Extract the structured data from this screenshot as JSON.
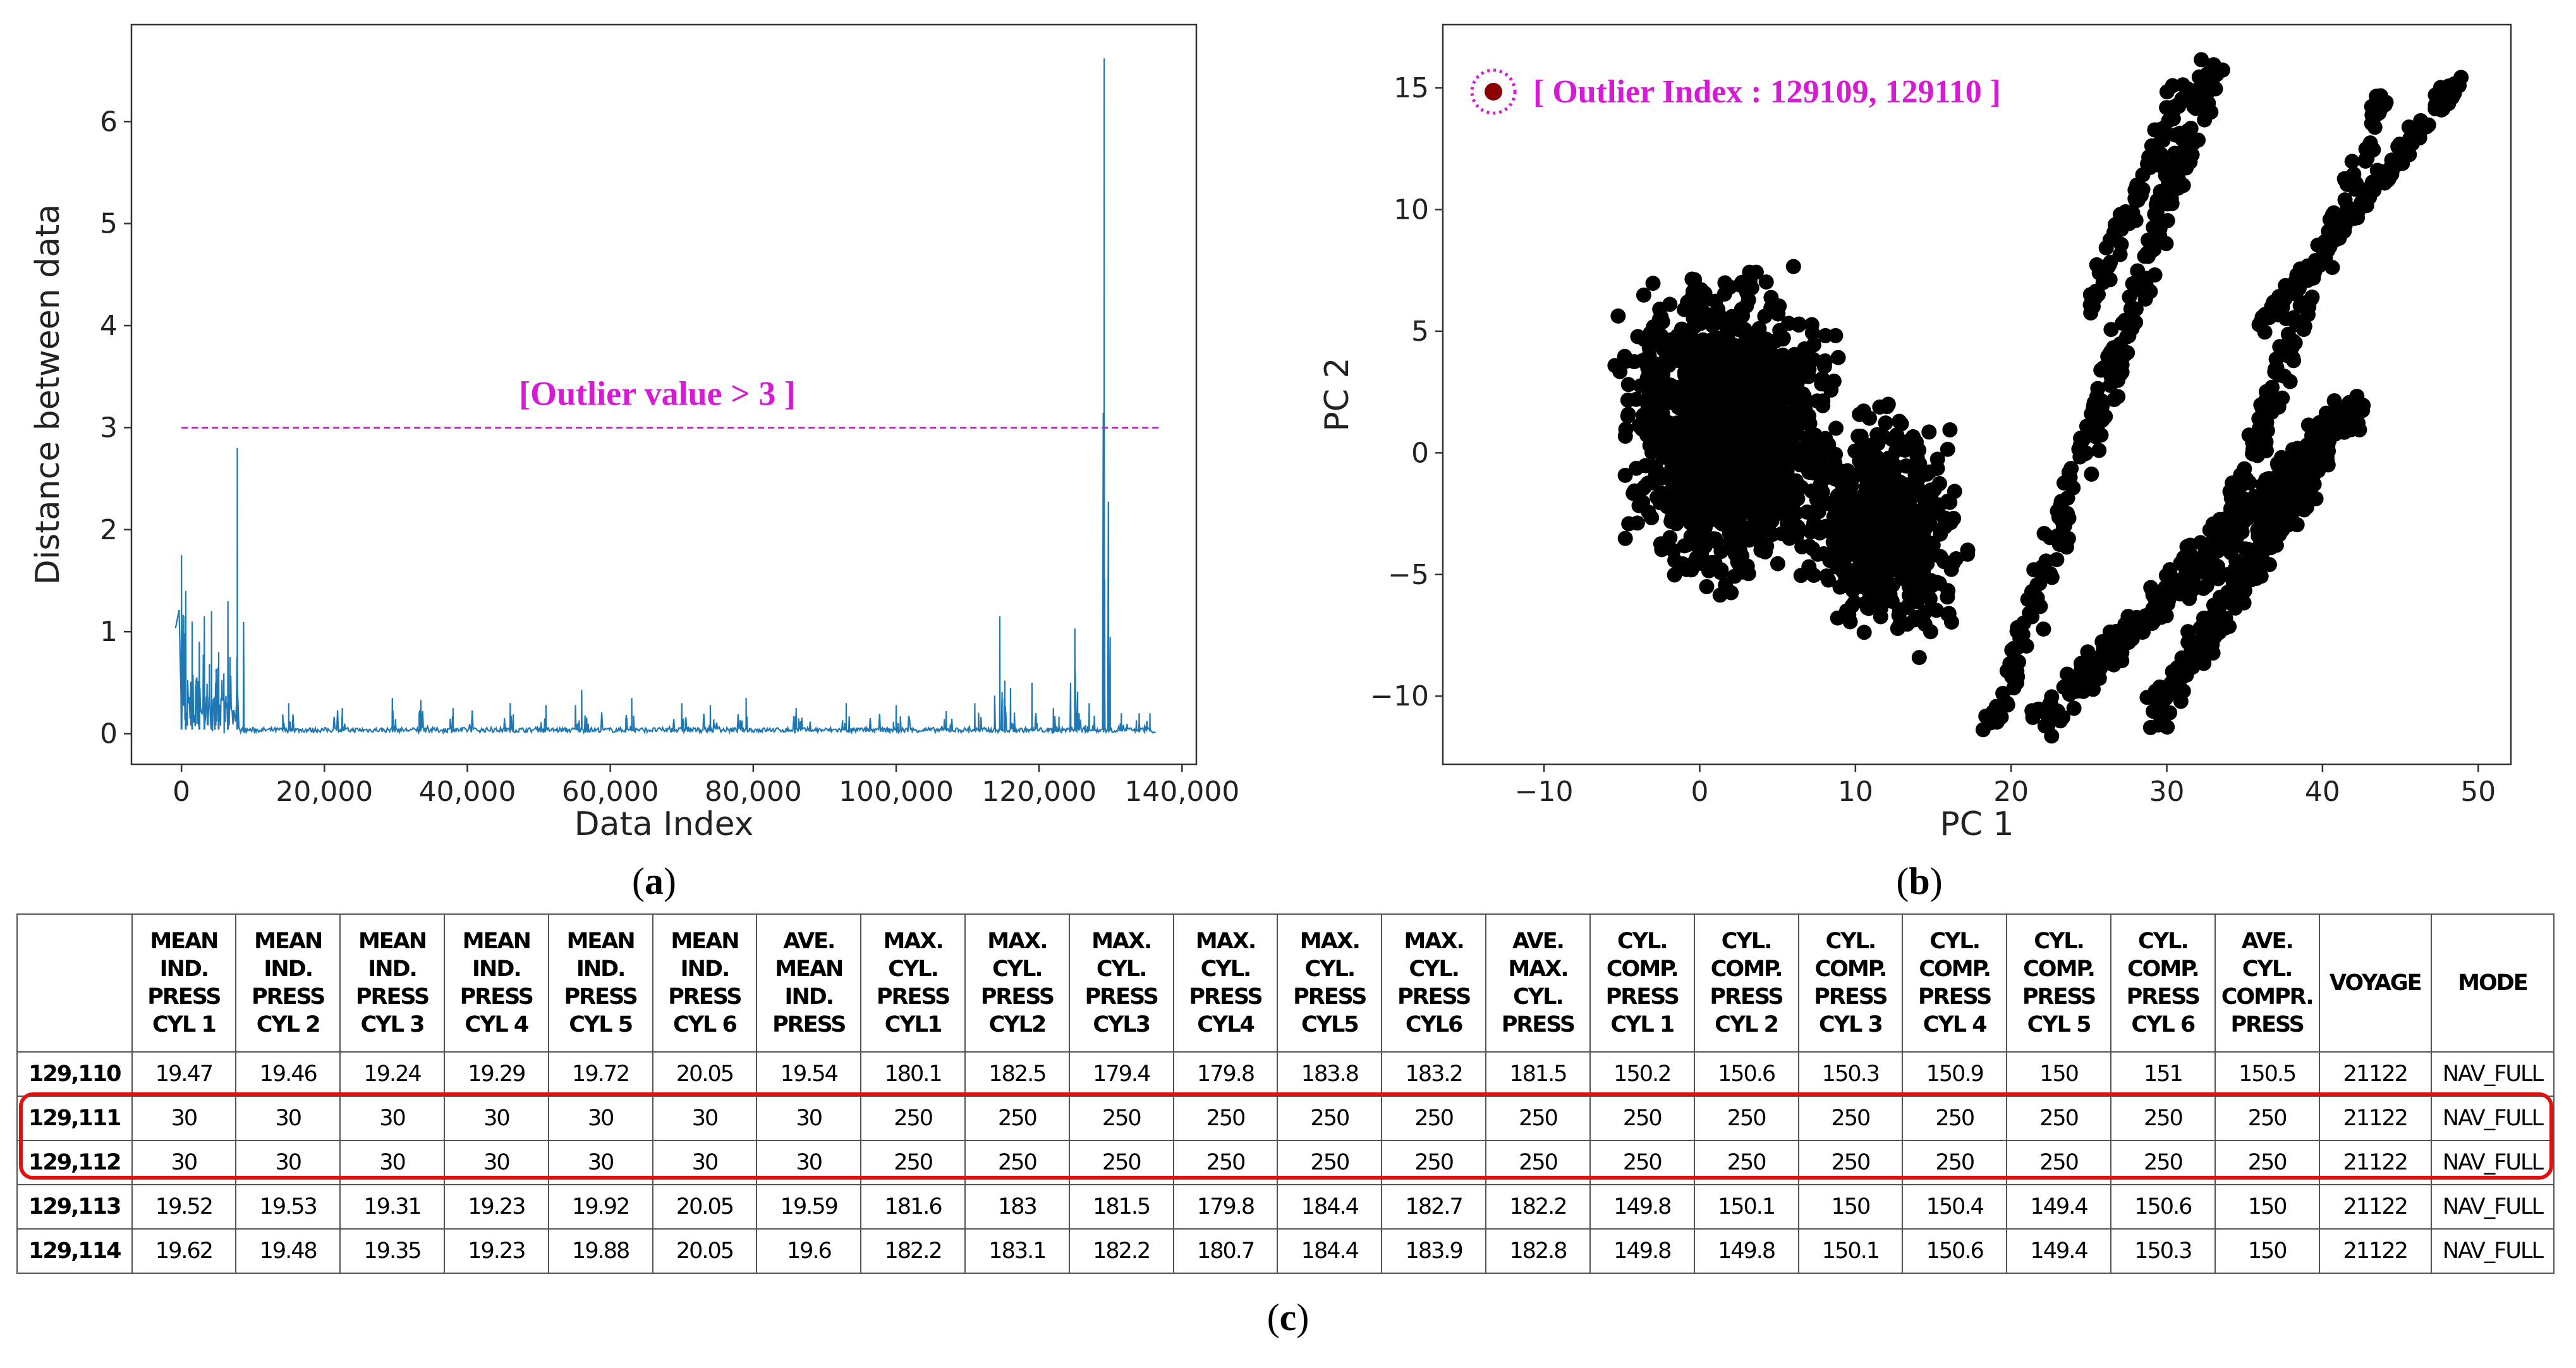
{
  "chart_data": [
    {
      "type": "line",
      "id": "a",
      "caption": "a",
      "xlabel": "Data Index",
      "ylabel": "Distance between data",
      "xlim": [
        -7000,
        142000
      ],
      "ylim": [
        -0.3,
        6.95
      ],
      "xticks": [
        0,
        20000,
        40000,
        60000,
        80000,
        100000,
        120000,
        140000
      ],
      "xtick_labels": [
        "0",
        "20,000",
        "40,000",
        "60,000",
        "80,000",
        "100,000",
        "120,000",
        "140,000"
      ],
      "yticks": [
        0,
        1,
        2,
        3,
        4,
        5,
        6
      ],
      "ytick_labels": [
        "0",
        "1",
        "2",
        "3",
        "4",
        "5",
        "6"
      ],
      "series_color": "#1f77b4",
      "peaks": [
        [
          0,
          1.75
        ],
        [
          600,
          1.4
        ],
        [
          1500,
          1.1
        ],
        [
          2500,
          0.9
        ],
        [
          3200,
          1.15
        ],
        [
          4200,
          1.2
        ],
        [
          5200,
          0.8
        ],
        [
          6500,
          1.3
        ],
        [
          7800,
          2.8
        ],
        [
          15000,
          0.3
        ],
        [
          22500,
          0.25
        ],
        [
          29500,
          0.35
        ],
        [
          33500,
          0.33
        ],
        [
          38000,
          0.25
        ],
        [
          46000,
          0.3
        ],
        [
          51000,
          0.28
        ],
        [
          56000,
          0.43
        ],
        [
          63000,
          0.35
        ],
        [
          70000,
          0.3
        ],
        [
          74000,
          0.28
        ],
        [
          79000,
          0.35
        ],
        [
          86000,
          0.25
        ],
        [
          93000,
          0.3
        ],
        [
          100000,
          0.28
        ],
        [
          107000,
          0.22
        ],
        [
          111000,
          0.3
        ],
        [
          114500,
          1.15
        ],
        [
          116000,
          0.45
        ],
        [
          119000,
          0.5
        ],
        [
          122000,
          0.25
        ],
        [
          125000,
          1.03
        ],
        [
          127000,
          0.3
        ],
        [
          129110,
          6.62
        ],
        [
          131500,
          0.2
        ],
        [
          134000,
          0.2
        ],
        [
          135500,
          0.2
        ]
      ],
      "baseline": 0.04,
      "threshold": {
        "value": 3,
        "label": "[Outlier value > 3 ]",
        "color": "#d61ad6"
      }
    },
    {
      "type": "scatter",
      "id": "b",
      "caption": "b",
      "xlabel": "PC 1",
      "ylabel": "PC 2",
      "xlim": [
        -16.5,
        52.1
      ],
      "ylim": [
        -12.8,
        17.6
      ],
      "xticks": [
        -10,
        0,
        10,
        20,
        30,
        40,
        50
      ],
      "xtick_labels": [
        "−10",
        "0",
        "10",
        "20",
        "30",
        "40",
        "50"
      ],
      "yticks": [
        -10,
        -5,
        0,
        5,
        10,
        15
      ],
      "ytick_labels": [
        "−10",
        "−5",
        "0",
        "5",
        "10",
        "15"
      ],
      "point_color": "#000000",
      "clusters": [
        {
          "kind": "blob",
          "center": [
            2,
            1
          ],
          "spread": [
            8.5,
            7.5
          ],
          "n": 1400
        },
        {
          "kind": "blob",
          "center": [
            12,
            -3
          ],
          "spread": [
            6,
            6
          ],
          "n": 500
        },
        {
          "kind": "stripe",
          "from": [
            19,
            -11
          ],
          "to": [
            33,
            16
          ],
          "width": 1.2,
          "n": 260
        },
        {
          "kind": "stripe",
          "from": [
            22,
            -11
          ],
          "to": [
            42,
            2
          ],
          "width": 1.6,
          "n": 320
        },
        {
          "kind": "stripe",
          "from": [
            29,
            -11
          ],
          "to": [
            42,
            2
          ],
          "width": 1.5,
          "n": 260
        },
        {
          "kind": "stripe",
          "from": [
            32,
            -6
          ],
          "to": [
            44,
            15
          ],
          "width": 1.0,
          "n": 160
        },
        {
          "kind": "stripe",
          "from": [
            36,
            5
          ],
          "to": [
            49,
            15.5
          ],
          "width": 0.8,
          "n": 140
        },
        {
          "kind": "stripe",
          "from": [
            25,
            6
          ],
          "to": [
            31,
            15
          ],
          "width": 1.0,
          "n": 80
        }
      ],
      "legend": {
        "label": "[ Outlier Index : 129109, 129110 ]",
        "color": "#d61ad6",
        "marker_color": "#8b0000"
      }
    }
  ],
  "table": {
    "caption": "c",
    "headers": [
      "",
      "MEAN IND. PRESS CYL 1",
      "MEAN IND. PRESS CYL 2",
      "MEAN IND. PRESS CYL 3",
      "MEAN IND. PRESS CYL 4",
      "MEAN IND. PRESS CYL 5",
      "MEAN IND. PRESS CYL 6",
      "AVE. MEAN IND. PRESS",
      "MAX. CYL. PRESS CYL1",
      "MAX. CYL. PRESS CYL2",
      "MAX. CYL. PRESS CYL3",
      "MAX. CYL. PRESS CYL4",
      "MAX. CYL. PRESS CYL5",
      "MAX. CYL. PRESS CYL6",
      "AVE. MAX. CYL. PRESS",
      "CYL. COMP. PRESS CYL 1",
      "CYL. COMP. PRESS CYL 2",
      "CYL. COMP. PRESS CYL 3",
      "CYL. COMP. PRESS CYL 4",
      "CYL. COMP. PRESS CYL 5",
      "CYL. COMP. PRESS CYL 6",
      "AVE. CYL. COMPR. PRESS",
      "VOYAGE",
      "MODE"
    ],
    "rows": [
      [
        "129,110",
        "19.47",
        "19.46",
        "19.24",
        "19.29",
        "19.72",
        "20.05",
        "19.54",
        "180.1",
        "182.5",
        "179.4",
        "179.8",
        "183.8",
        "183.2",
        "181.5",
        "150.2",
        "150.6",
        "150.3",
        "150.9",
        "150",
        "151",
        "150.5",
        "21122",
        "NAV_FULL"
      ],
      [
        "129,111",
        "30",
        "30",
        "30",
        "30",
        "30",
        "30",
        "30",
        "250",
        "250",
        "250",
        "250",
        "250",
        "250",
        "250",
        "250",
        "250",
        "250",
        "250",
        "250",
        "250",
        "250",
        "21122",
        "NAV_FULL"
      ],
      [
        "129,112",
        "30",
        "30",
        "30",
        "30",
        "30",
        "30",
        "30",
        "250",
        "250",
        "250",
        "250",
        "250",
        "250",
        "250",
        "250",
        "250",
        "250",
        "250",
        "250",
        "250",
        "250",
        "21122",
        "NAV_FULL"
      ],
      [
        "129,113",
        "19.52",
        "19.53",
        "19.31",
        "19.23",
        "19.92",
        "20.05",
        "19.59",
        "181.6",
        "183",
        "181.5",
        "179.8",
        "184.4",
        "182.7",
        "182.2",
        "149.8",
        "150.1",
        "150",
        "150.4",
        "149.4",
        "150.6",
        "150",
        "21122",
        "NAV_FULL"
      ],
      [
        "129,114",
        "19.62",
        "19.48",
        "19.35",
        "19.23",
        "19.88",
        "20.05",
        "19.6",
        "182.2",
        "183.1",
        "182.2",
        "180.7",
        "184.4",
        "183.9",
        "182.8",
        "149.8",
        "149.8",
        "150.1",
        "150.6",
        "149.4",
        "150.3",
        "150",
        "21122",
        "NAV_FULL"
      ]
    ],
    "highlight_color": "#e01010"
  }
}
